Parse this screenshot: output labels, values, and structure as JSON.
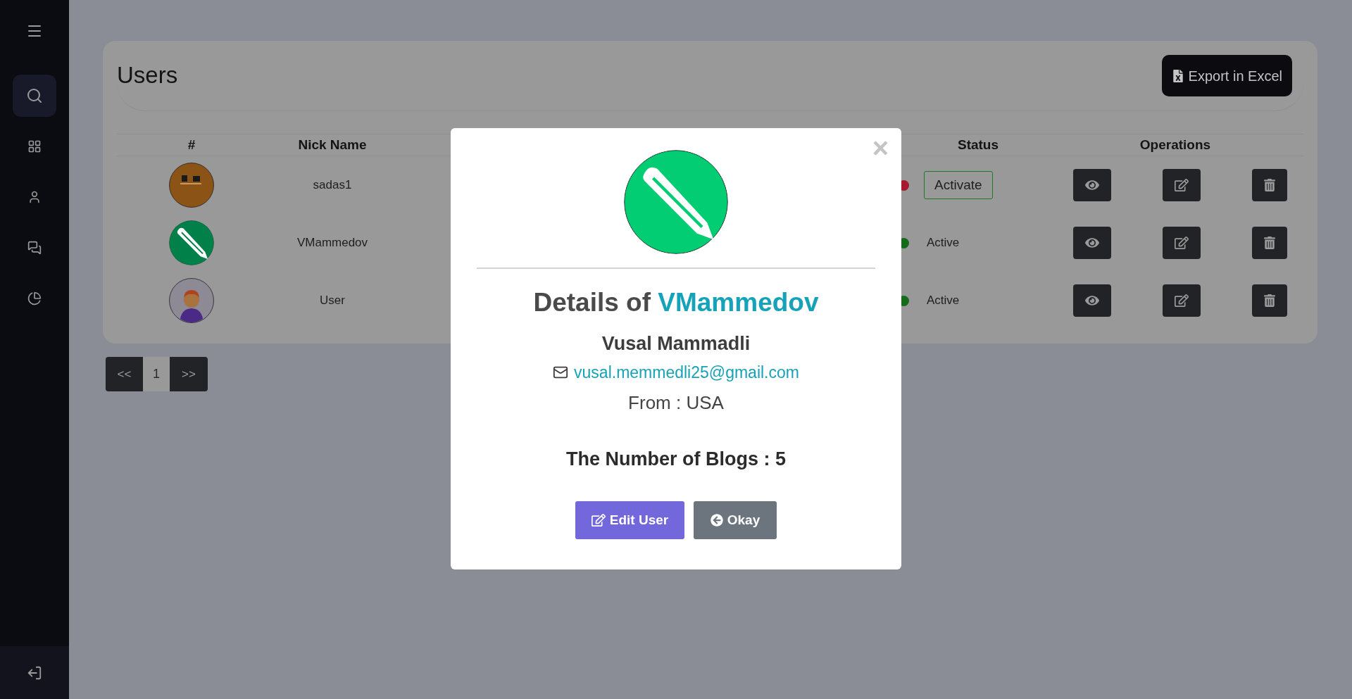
{
  "sidebar": {
    "items": [
      {
        "kind": "search",
        "selected": true
      },
      {
        "kind": "grid",
        "selected": false
      },
      {
        "kind": "user",
        "selected": false
      },
      {
        "kind": "chat",
        "selected": false
      },
      {
        "kind": "chart",
        "selected": false
      }
    ]
  },
  "page": {
    "title": "Users",
    "export_button": "Export in Excel"
  },
  "table": {
    "columns": [
      "#",
      "Nick Name",
      "Status",
      "Operations"
    ],
    "rows": [
      {
        "nick": "sadas1",
        "status": {
          "kind": "button",
          "label": "Activate",
          "color": "#a6192e"
        }
      },
      {
        "avatar": {
          "kind": "pencil"
        },
        "nick": "VMammedov",
        "status": {
          "kind": "text",
          "label": "Active",
          "color": "#166b1b"
        }
      },
      {
        "avatar": {
          "kind": "person"
        },
        "nick": "User",
        "status": {
          "kind": "text",
          "label": "Active",
          "color": "#166b1b"
        }
      }
    ]
  },
  "pagination": {
    "prev": "<<",
    "pages": [
      {
        "label": "1",
        "selected": true
      }
    ],
    "next": ">>"
  },
  "modal": {
    "close": "×",
    "avatar": {
      "kind": "pencil"
    },
    "title_prefix": "Details of",
    "title_name": "VMammedov",
    "full_name": "Vusal Mammadli",
    "email": "vusal.memmedli25@gmail.com",
    "from": "From : USA",
    "blogs": "The Number of Blogs : 5",
    "buttons": [
      {
        "kind": "primary",
        "label": "Edit User"
      },
      {
        "kind": "secondary",
        "label": "Okay"
      }
    ]
  }
}
